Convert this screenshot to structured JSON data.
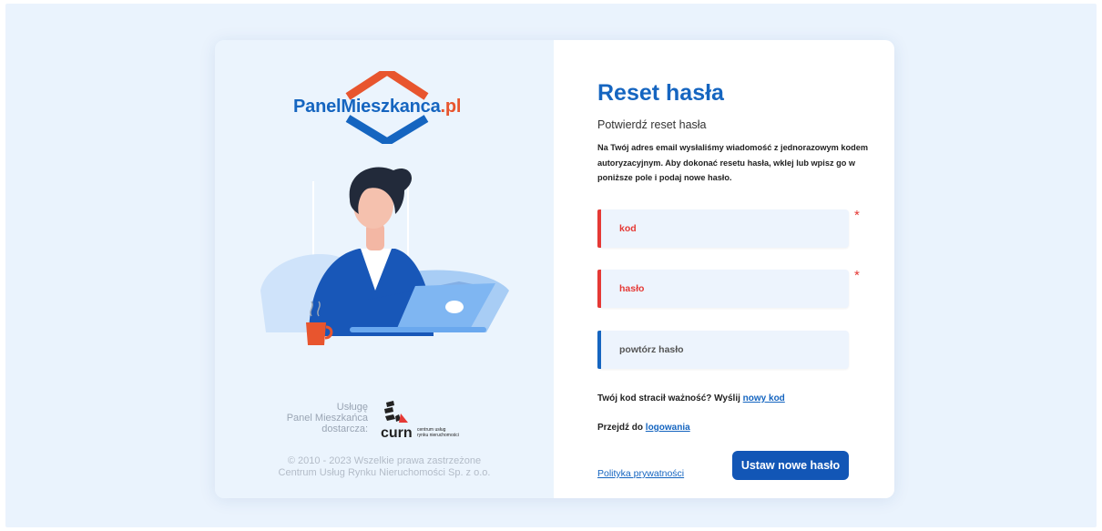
{
  "brand": {
    "logo_main": "PanelMieszkanca",
    "logo_tld": ".pl",
    "colors": {
      "primary": "#1565c0",
      "accent": "#e8552e",
      "error": "#e53935"
    }
  },
  "supplier": {
    "line1": "Usługę",
    "line2": "Panel Mieszkańca",
    "line3": "dostarcza:",
    "logo_text": "curn",
    "logo_sub1": "centrum usług",
    "logo_sub2": "rynku nieruchomości"
  },
  "copyright": {
    "line1": "© 2010 - 2023 Wszelkie prawa zastrzeżone",
    "line2": "Centrum Usług Rynku Nieruchomości Sp. z o.o."
  },
  "form": {
    "title": "Reset hasła",
    "subtitle": "Potwierdź reset hasła",
    "description": "Na Twój adres email wysłaliśmy wiadomość z jednorazowym kodem autoryzacyjnym. Aby dokonać resetu hasła, wklej lub wpisz go w poniższe pole i podaj nowe hasło.",
    "fields": [
      {
        "label": "kod",
        "required": true,
        "state": "error"
      },
      {
        "label": "hasło",
        "required": true,
        "state": "error"
      },
      {
        "label": "powtórz hasło",
        "required": false,
        "state": "default"
      }
    ],
    "required_marker": "*",
    "expired_text": "Twój kod stracił ważność? Wyślij",
    "expired_link": "nowy kod",
    "login_text": "Przejdź do",
    "login_link": "logowania",
    "privacy_link": "Polityka prywatności",
    "submit_label": "Ustaw nowe hasło"
  }
}
